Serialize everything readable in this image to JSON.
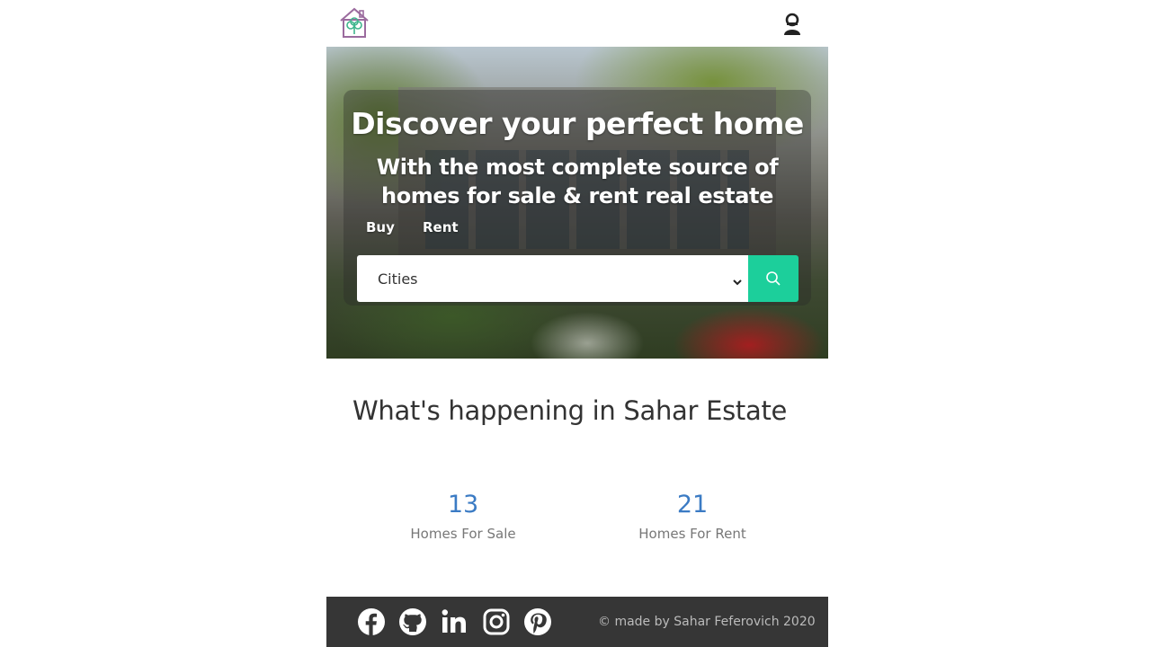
{
  "header": {
    "logo_icon": "house-logo-icon",
    "user_icon": "user-icon"
  },
  "hero": {
    "title": "Discover your perfect home",
    "subtitle_line1": "With the most complete source of",
    "subtitle_line2": "homes for sale & rent real estate",
    "tabs": [
      {
        "label": "Buy"
      },
      {
        "label": "Rent"
      }
    ],
    "search": {
      "selected_value": "Cities",
      "button_icon": "search-icon"
    }
  },
  "stats": {
    "title": "What's happening in Sahar Estate",
    "items": [
      {
        "number": "13",
        "label": "Homes For Sale"
      },
      {
        "number": "21",
        "label": "Homes For Rent"
      }
    ]
  },
  "footer": {
    "social": [
      "facebook-icon",
      "github-icon",
      "linkedin-icon",
      "instagram-icon",
      "pinterest-icon"
    ],
    "copyright": "© made by Sahar Feferovich 2020"
  },
  "colors": {
    "accent": "#1ccf9b",
    "stat_number": "#3b7bc4",
    "footer_bg": "#363636"
  }
}
